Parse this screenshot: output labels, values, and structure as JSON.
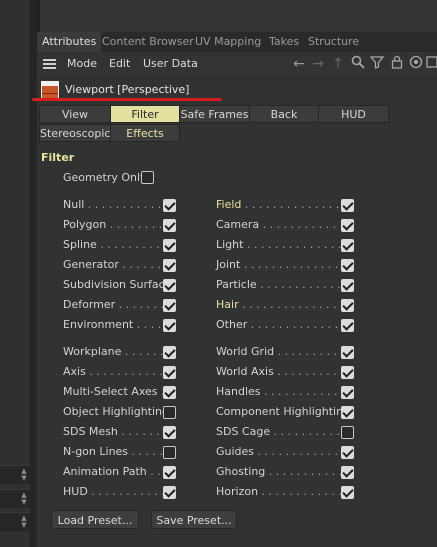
{
  "tabs": [
    "Attributes",
    "Content Browser",
    "UV Mapping",
    "Takes",
    "Structure"
  ],
  "menu": {
    "mode": "Mode",
    "edit": "Edit",
    "user_data": "User Data"
  },
  "toolbar_icons": [
    "arrow-left-icon",
    "arrow-right-icon",
    "arrow-up-icon",
    "search-icon",
    "filter-icon",
    "lock-icon",
    "target-icon",
    "new-window-icon"
  ],
  "header": {
    "title": "Viewport [Perspective]"
  },
  "subtabs_row1": [
    "View",
    "Filter",
    "Safe Frames",
    "Back",
    "HUD"
  ],
  "subtabs_row2": [
    "Stereoscopic",
    "Effects"
  ],
  "active_subtab": "Filter",
  "section_title": "Filter",
  "geometry_only": {
    "label": "Geometry Only",
    "checked": false
  },
  "left_items": [
    {
      "label": "Null",
      "dots": " . . . . . . . . . . .",
      "checked": true
    },
    {
      "label": "Polygon",
      "dots": " . . . . . . . . .",
      "checked": true
    },
    {
      "label": "Spline",
      "dots": " . . . . . . . . . .",
      "checked": true
    },
    {
      "label": "Generator",
      "dots": " . . . . . . .",
      "checked": true
    },
    {
      "label": "Subdivision Surface",
      "dots": "",
      "checked": true
    },
    {
      "label": "Deformer",
      "dots": " . . . . . . . .",
      "checked": true
    },
    {
      "label": "Environment",
      "dots": " . . . . .",
      "checked": true
    },
    {
      "label": "Workplane",
      "dots": " . . . . . . .",
      "checked": true
    },
    {
      "label": "Axis",
      "dots": " . . . . . . . . . . . .",
      "checked": true
    },
    {
      "label": "Multi-Select Axes",
      "dots": " .",
      "checked": true
    },
    {
      "label": "Object Highlighting",
      "dots": "",
      "checked": false
    },
    {
      "label": "SDS Mesh",
      "dots": " . . . . . . .",
      "checked": true
    },
    {
      "label": "N-gon Lines",
      "dots": " . . . . .",
      "checked": false
    },
    {
      "label": "Animation Path",
      "dots": " . .",
      "checked": true
    },
    {
      "label": "HUD",
      "dots": " . . . . . . . . . . . .",
      "checked": true
    }
  ],
  "right_items": [
    {
      "label": "Field",
      "dots": " . . . . . . . . . . . . . . .",
      "checked": true,
      "highlight": true
    },
    {
      "label": "Camera",
      "dots": " . . . . . . . . . . . .",
      "checked": true
    },
    {
      "label": "Light",
      "dots": " . . . . . . . . . . . . . . .",
      "checked": true
    },
    {
      "label": "Joint",
      "dots": " . . . . . . . . . . . . . . .",
      "checked": true
    },
    {
      "label": "Particle",
      "dots": " . . . . . . . . . . . . .",
      "checked": true
    },
    {
      "label": "Hair",
      "dots": " . . . . . . . . . . . . . . . .",
      "checked": true,
      "highlight": true
    },
    {
      "label": "Other",
      "dots": " . . . . . . . . . . . . . .",
      "checked": true
    },
    {
      "label": "World Grid",
      "dots": " . . . . . . . . .",
      "checked": true
    },
    {
      "label": "World Axis",
      "dots": " . . . . . . . . .",
      "checked": true
    },
    {
      "label": "Handles",
      "dots": " . . . . . . . . . . .",
      "checked": true
    },
    {
      "label": "Component Highlighting",
      "dots": "",
      "checked": true
    },
    {
      "label": "SDS Cage",
      "dots": " . . . . . . . . . . .",
      "checked": false
    },
    {
      "label": "Guides",
      "dots": " . . . . . . . . . . . . . .",
      "checked": true
    },
    {
      "label": "Ghosting",
      "dots": " . . . . . . . . . . . .",
      "checked": true
    },
    {
      "label": "Horizon",
      "dots": " . . . . . . . . . . . . .",
      "checked": true
    }
  ],
  "buttons": {
    "load_preset": "Load Preset...",
    "save_preset": "Save Preset..."
  },
  "colors": {
    "accent_yellow": "#e3e1a0",
    "underline_red": "#d31f1f",
    "panel_bg": "#323232"
  }
}
